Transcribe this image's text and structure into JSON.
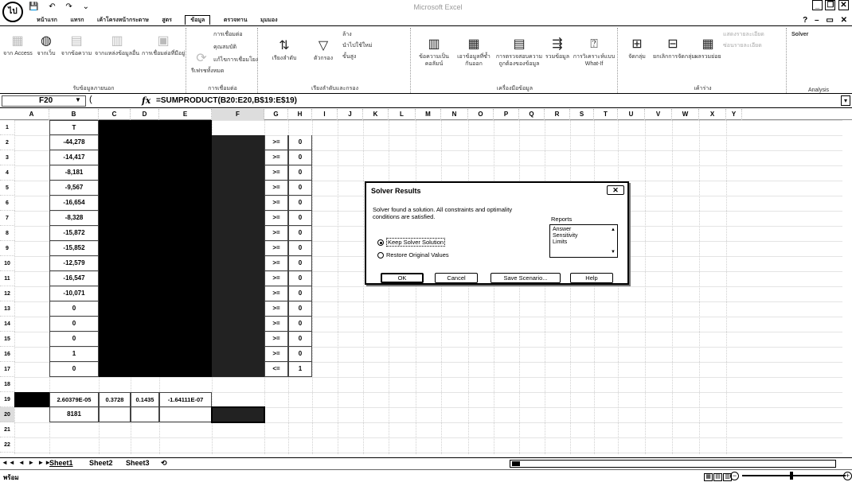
{
  "window": {
    "title": "Microsoft Excel",
    "office_button": "ไป",
    "qat": [
      "💾",
      "↶",
      "↷",
      "⌄"
    ],
    "controls": [
      "_",
      "❐",
      "✕"
    ]
  },
  "ribbon": {
    "tabs": [
      "หน้าแรก",
      "แทรก",
      "เค้าโครงหน้ากระดาษ",
      "สูตร",
      "ข้อมูล",
      "ตรวจทาน",
      "มุมมอง"
    ],
    "active_tab_index": 4,
    "help": [
      "?",
      "–",
      "▭",
      "✕"
    ],
    "groups": [
      {
        "label": "รับข้อมูลภายนอก",
        "buttons": [
          "จาก Access",
          "จากเว็บ",
          "จากข้อความ",
          "จากแหล่งข้อมูลอื่น",
          "การเชื่อมต่อที่มีอยู่"
        ]
      },
      {
        "label": "การเชื่อมต่อ",
        "buttons": [
          "รีเฟรชทั้งหมด",
          "การเชื่อมต่อ",
          "คุณสมบัติ",
          "แก้ไขการเชื่อมโยง"
        ]
      },
      {
        "label": "เรียงลำดับและกรอง",
        "buttons": [
          "เรียงลำดับ",
          "ตัวกรอง",
          "ล้าง",
          "นำไปใช้ใหม่",
          "ขั้นสูง"
        ]
      },
      {
        "label": "เครื่องมือข้อมูล",
        "buttons": [
          "ข้อความเป็นคอลัมน์",
          "เอาข้อมูลที่ซ้ำกันออก",
          "การตรวจสอบความถูกต้องของข้อมูล",
          "รวมข้อมูล",
          "การวิเคราะห์แบบ What-If"
        ]
      },
      {
        "label": "เค้าร่าง",
        "buttons": [
          "จัดกลุ่ม",
          "ยกเลิกการจัดกลุ่ม",
          "ผลรวมย่อย",
          "แสดงรายละเอียด",
          "ซ่อนรายละเอียด"
        ]
      },
      {
        "label": "Analysis",
        "buttons": [
          "Solver"
        ]
      }
    ]
  },
  "formula_bar": {
    "cell_ref": "F20",
    "fx": "fx",
    "formula": "=SUMPRODUCT(B20:E20,B$19:E$19)"
  },
  "grid": {
    "columns": [
      "A",
      "B",
      "C",
      "D",
      "E",
      "F",
      "G",
      "H",
      "I",
      "J",
      "K",
      "L",
      "M",
      "N",
      "O",
      "P",
      "Q",
      "R",
      "S",
      "T",
      "U",
      "V",
      "W",
      "X",
      "Y"
    ],
    "rows": [
      "1",
      "2",
      "3",
      "4",
      "5",
      "6",
      "7",
      "8",
      "9",
      "10",
      "11",
      "12",
      "13",
      "14",
      "15",
      "16",
      "17",
      "18",
      "19",
      "20",
      "21",
      "22"
    ],
    "col_b_header": "T",
    "col_b_values": [
      "-44,278",
      "-14,417",
      "-8,181",
      "-9,567",
      "-16,654",
      "-8,328",
      "-15,872",
      "-15,852",
      "-12,579",
      "-16,547",
      "-10,071",
      "0",
      "0",
      "0",
      "1",
      "0"
    ],
    "col_g_values": [
      ">=",
      ">=",
      ">=",
      ">=",
      ">=",
      ">=",
      ">=",
      ">=",
      ">=",
      ">=",
      ">=",
      ">=",
      ">=",
      ">=",
      ">=",
      "<="
    ],
    "col_h_values": [
      "0",
      "0",
      "0",
      "0",
      "0",
      "0",
      "0",
      "0",
      "0",
      "0",
      "0",
      "0",
      "0",
      "0",
      "0",
      "1"
    ],
    "row19": [
      "2.60379E-05",
      "0.3728",
      "0.1435",
      "-1.64111E-07"
    ],
    "row20_b": "8181"
  },
  "dialog": {
    "title": "Solver Results",
    "message": "Solver found a solution.  All constraints and optimality conditions are satisfied.",
    "keep_label": "Keep Solver Solution",
    "restore_label": "Restore Original Values",
    "reports_label": "Reports",
    "reports": [
      "Answer",
      "Sensitivity",
      "Limits"
    ],
    "ok": "OK",
    "cancel": "Cancel",
    "save": "Save Scenario...",
    "help": "Help",
    "close": "✕"
  },
  "sheets": {
    "nav": "◄◄ ◄ ► ►►",
    "tabs": [
      "Sheet1",
      "Sheet2",
      "Sheet3"
    ],
    "new_tab": "⟲"
  },
  "status": {
    "text": "พร้อม"
  }
}
